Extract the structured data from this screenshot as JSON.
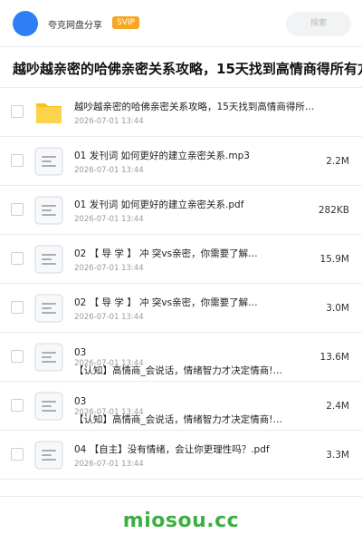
{
  "header": {
    "share_name": "夸克网盘分享",
    "badge": "SVIP",
    "search_label": "搜索"
  },
  "page": {
    "title": "越吵越亲密的哈佛亲密关系攻略，15天找到高情商得所有方"
  },
  "files": [
    {
      "type": "folder",
      "name": "越吵越亲密的哈佛亲密关系攻略，15天找到高情商得所…",
      "date": "2026-07-01 13:44",
      "size": ""
    },
    {
      "type": "doc",
      "name": "01 发刊词 如何更好的建立亲密关系.mp3",
      "date": "2026-07-01 13:44",
      "size": "2.2M"
    },
    {
      "type": "doc",
      "name": "01 发刊词 如何更好的建立亲密关系.pdf",
      "date": "2026-07-01 13:44",
      "size": "282KB"
    },
    {
      "type": "doc",
      "name": "02 【 导 学 】  冲 突vs亲密，你需要了解…",
      "date": "2026-07-01 13:44",
      "size": "15.9M"
    },
    {
      "type": "doc",
      "name": "02 【 导 学 】  冲 突vs亲密，你需要了解…",
      "date": "2026-07-01 13:44",
      "size": "3.0M"
    },
    {
      "type": "doc",
      "name": "03",
      "name2": "【认知】高情商_会说话，情绪智力才决定情商!…",
      "date": "2026-07-01 13:44",
      "size": "13.6M"
    },
    {
      "type": "doc",
      "name": "03",
      "name2": "【认知】高情商_会说话，情绪智力才决定情商!…",
      "date": "2026-07-01 13:44",
      "size": "2.4M"
    },
    {
      "type": "doc",
      "name": "04 【自主】没有情绪，会让你更理性吗？.pdf",
      "date": "2026-07-01 13:44",
      "size": "3.3M"
    }
  ],
  "watermark": "miosou.cc",
  "colors": {
    "avatar": "#2f7ef5",
    "svip": "#f5a623",
    "folder": "#f8c21c",
    "watermark": "#3cb043"
  },
  "icons": {
    "folder": "folder-icon",
    "doc": "document-icon"
  }
}
